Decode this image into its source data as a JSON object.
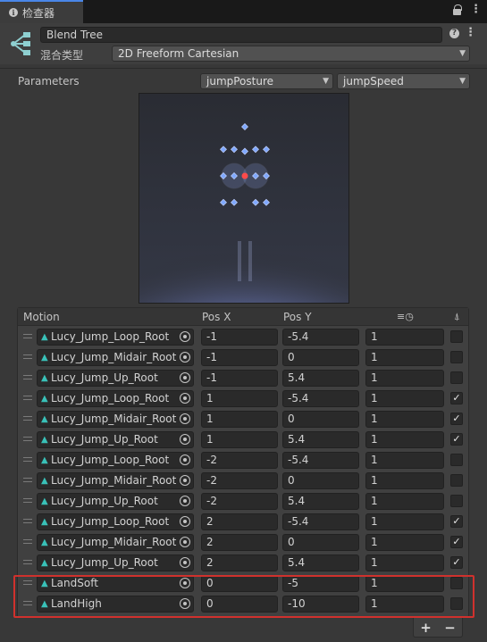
{
  "tab": {
    "title": "检查器"
  },
  "header": {
    "name": "Blend Tree",
    "blend_type_label": "混合类型",
    "blend_type_value": "2D Freeform Cartesian"
  },
  "parameters": {
    "label": "Parameters",
    "param_x": "jumpPosture",
    "param_y": "jumpSpeed"
  },
  "motion_list": {
    "columns": {
      "motion": "Motion",
      "pos_x": "Pos X",
      "pos_y": "Pos Y"
    },
    "rows": [
      {
        "clip": "Lucy_Jump_Loop_Root",
        "pos_x": "-1",
        "pos_y": "-5.4",
        "speed": "1",
        "mirror": false
      },
      {
        "clip": "Lucy_Jump_Midair_Root",
        "pos_x": "-1",
        "pos_y": "0",
        "speed": "1",
        "mirror": false
      },
      {
        "clip": "Lucy_Jump_Up_Root",
        "pos_x": "-1",
        "pos_y": "5.4",
        "speed": "1",
        "mirror": false
      },
      {
        "clip": "Lucy_Jump_Loop_Root",
        "pos_x": "1",
        "pos_y": "-5.4",
        "speed": "1",
        "mirror": true
      },
      {
        "clip": "Lucy_Jump_Midair_Root",
        "pos_x": "1",
        "pos_y": "0",
        "speed": "1",
        "mirror": true
      },
      {
        "clip": "Lucy_Jump_Up_Root",
        "pos_x": "1",
        "pos_y": "5.4",
        "speed": "1",
        "mirror": true
      },
      {
        "clip": "Lucy_Jump_Loop_Root",
        "pos_x": "-2",
        "pos_y": "-5.4",
        "speed": "1",
        "mirror": false
      },
      {
        "clip": "Lucy_Jump_Midair_Root",
        "pos_x": "-2",
        "pos_y": "0",
        "speed": "1",
        "mirror": false
      },
      {
        "clip": "Lucy_Jump_Up_Root",
        "pos_x": "-2",
        "pos_y": "5.4",
        "speed": "1",
        "mirror": false
      },
      {
        "clip": "Lucy_Jump_Loop_Root",
        "pos_x": "2",
        "pos_y": "-5.4",
        "speed": "1",
        "mirror": true
      },
      {
        "clip": "Lucy_Jump_Midair_Root",
        "pos_x": "2",
        "pos_y": "0",
        "speed": "1",
        "mirror": true
      },
      {
        "clip": "Lucy_Jump_Up_Root",
        "pos_x": "2",
        "pos_y": "5.4",
        "speed": "1",
        "mirror": true
      },
      {
        "clip": "LandSoft",
        "pos_x": "0",
        "pos_y": "-5",
        "speed": "1",
        "mirror": false
      },
      {
        "clip": "LandHigh",
        "pos_x": "0",
        "pos_y": "-10",
        "speed": "1",
        "mirror": false
      }
    ]
  },
  "footer": {
    "add": "+",
    "remove": "−"
  },
  "colors": {
    "accent": "#4a86e8",
    "highlight": "#d0312d",
    "clip_icon": "#39c1b8",
    "sample_point": "#7fa8ff",
    "current_point": "#ff4b4b"
  }
}
